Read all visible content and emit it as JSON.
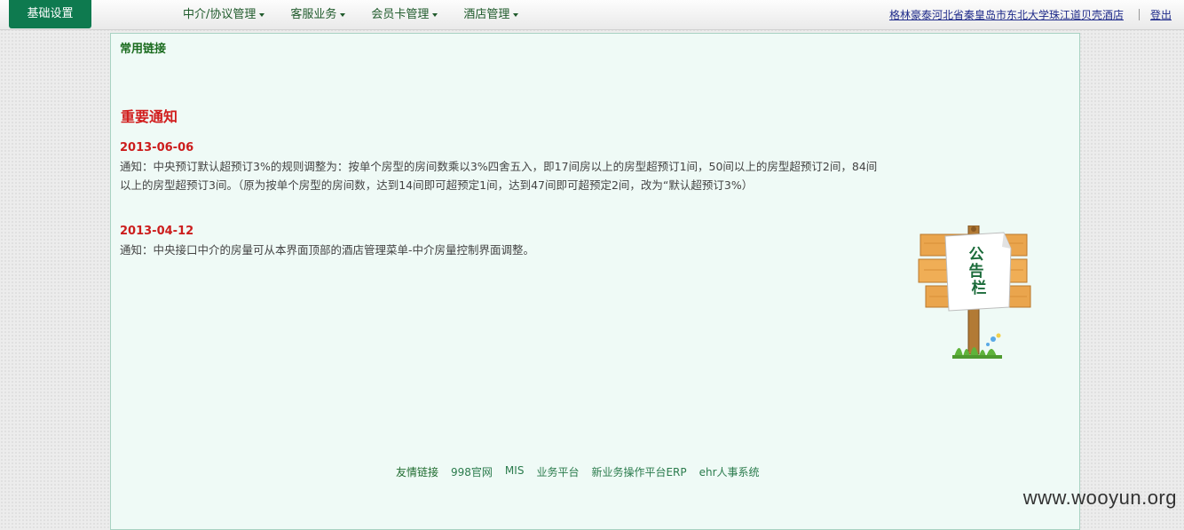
{
  "header": {
    "brand": "基础设置",
    "menus": [
      {
        "label": "中介/协议管理"
      },
      {
        "label": "客服业务"
      },
      {
        "label": "会员卡管理"
      },
      {
        "label": "酒店管理"
      }
    ],
    "hotel_link": "格林豪泰河北省秦皇岛市东北大学珠江道贝壳酒店",
    "logout": "登出"
  },
  "main": {
    "links_title": "常用链接",
    "notice_title": "重要通知",
    "notices": [
      {
        "date": "2013-06-06",
        "text": "通知：中央预订默认超预订3%的规则调整为：按单个房型的房间数乘以3%四舍五入，即17间房以上的房型超预订1间，50间以上的房型超预订2间，84间以上的房型超预订3间。（原为按单个房型的房间数，达到14间即可超预定1间，达到47间即可超预定2间，改为“默认超预订3%）"
      },
      {
        "date": "2013-04-12",
        "text": "通知：中央接口中介的房量可从本界面顶部的酒店管理菜单-中介房量控制界面调整。"
      }
    ],
    "bulletin_board_text": "公告栏"
  },
  "footer": {
    "label": "友情链接",
    "links": [
      "998官网",
      "MIS",
      "业务平台",
      "新业务操作平台ERP",
      "ehr人事系统"
    ]
  },
  "watermark": "www.wooyun.org",
  "colors": {
    "brand_green": "#0e7a4f",
    "date_red": "#cc1d1d",
    "panel_bg": "#effaf6"
  }
}
